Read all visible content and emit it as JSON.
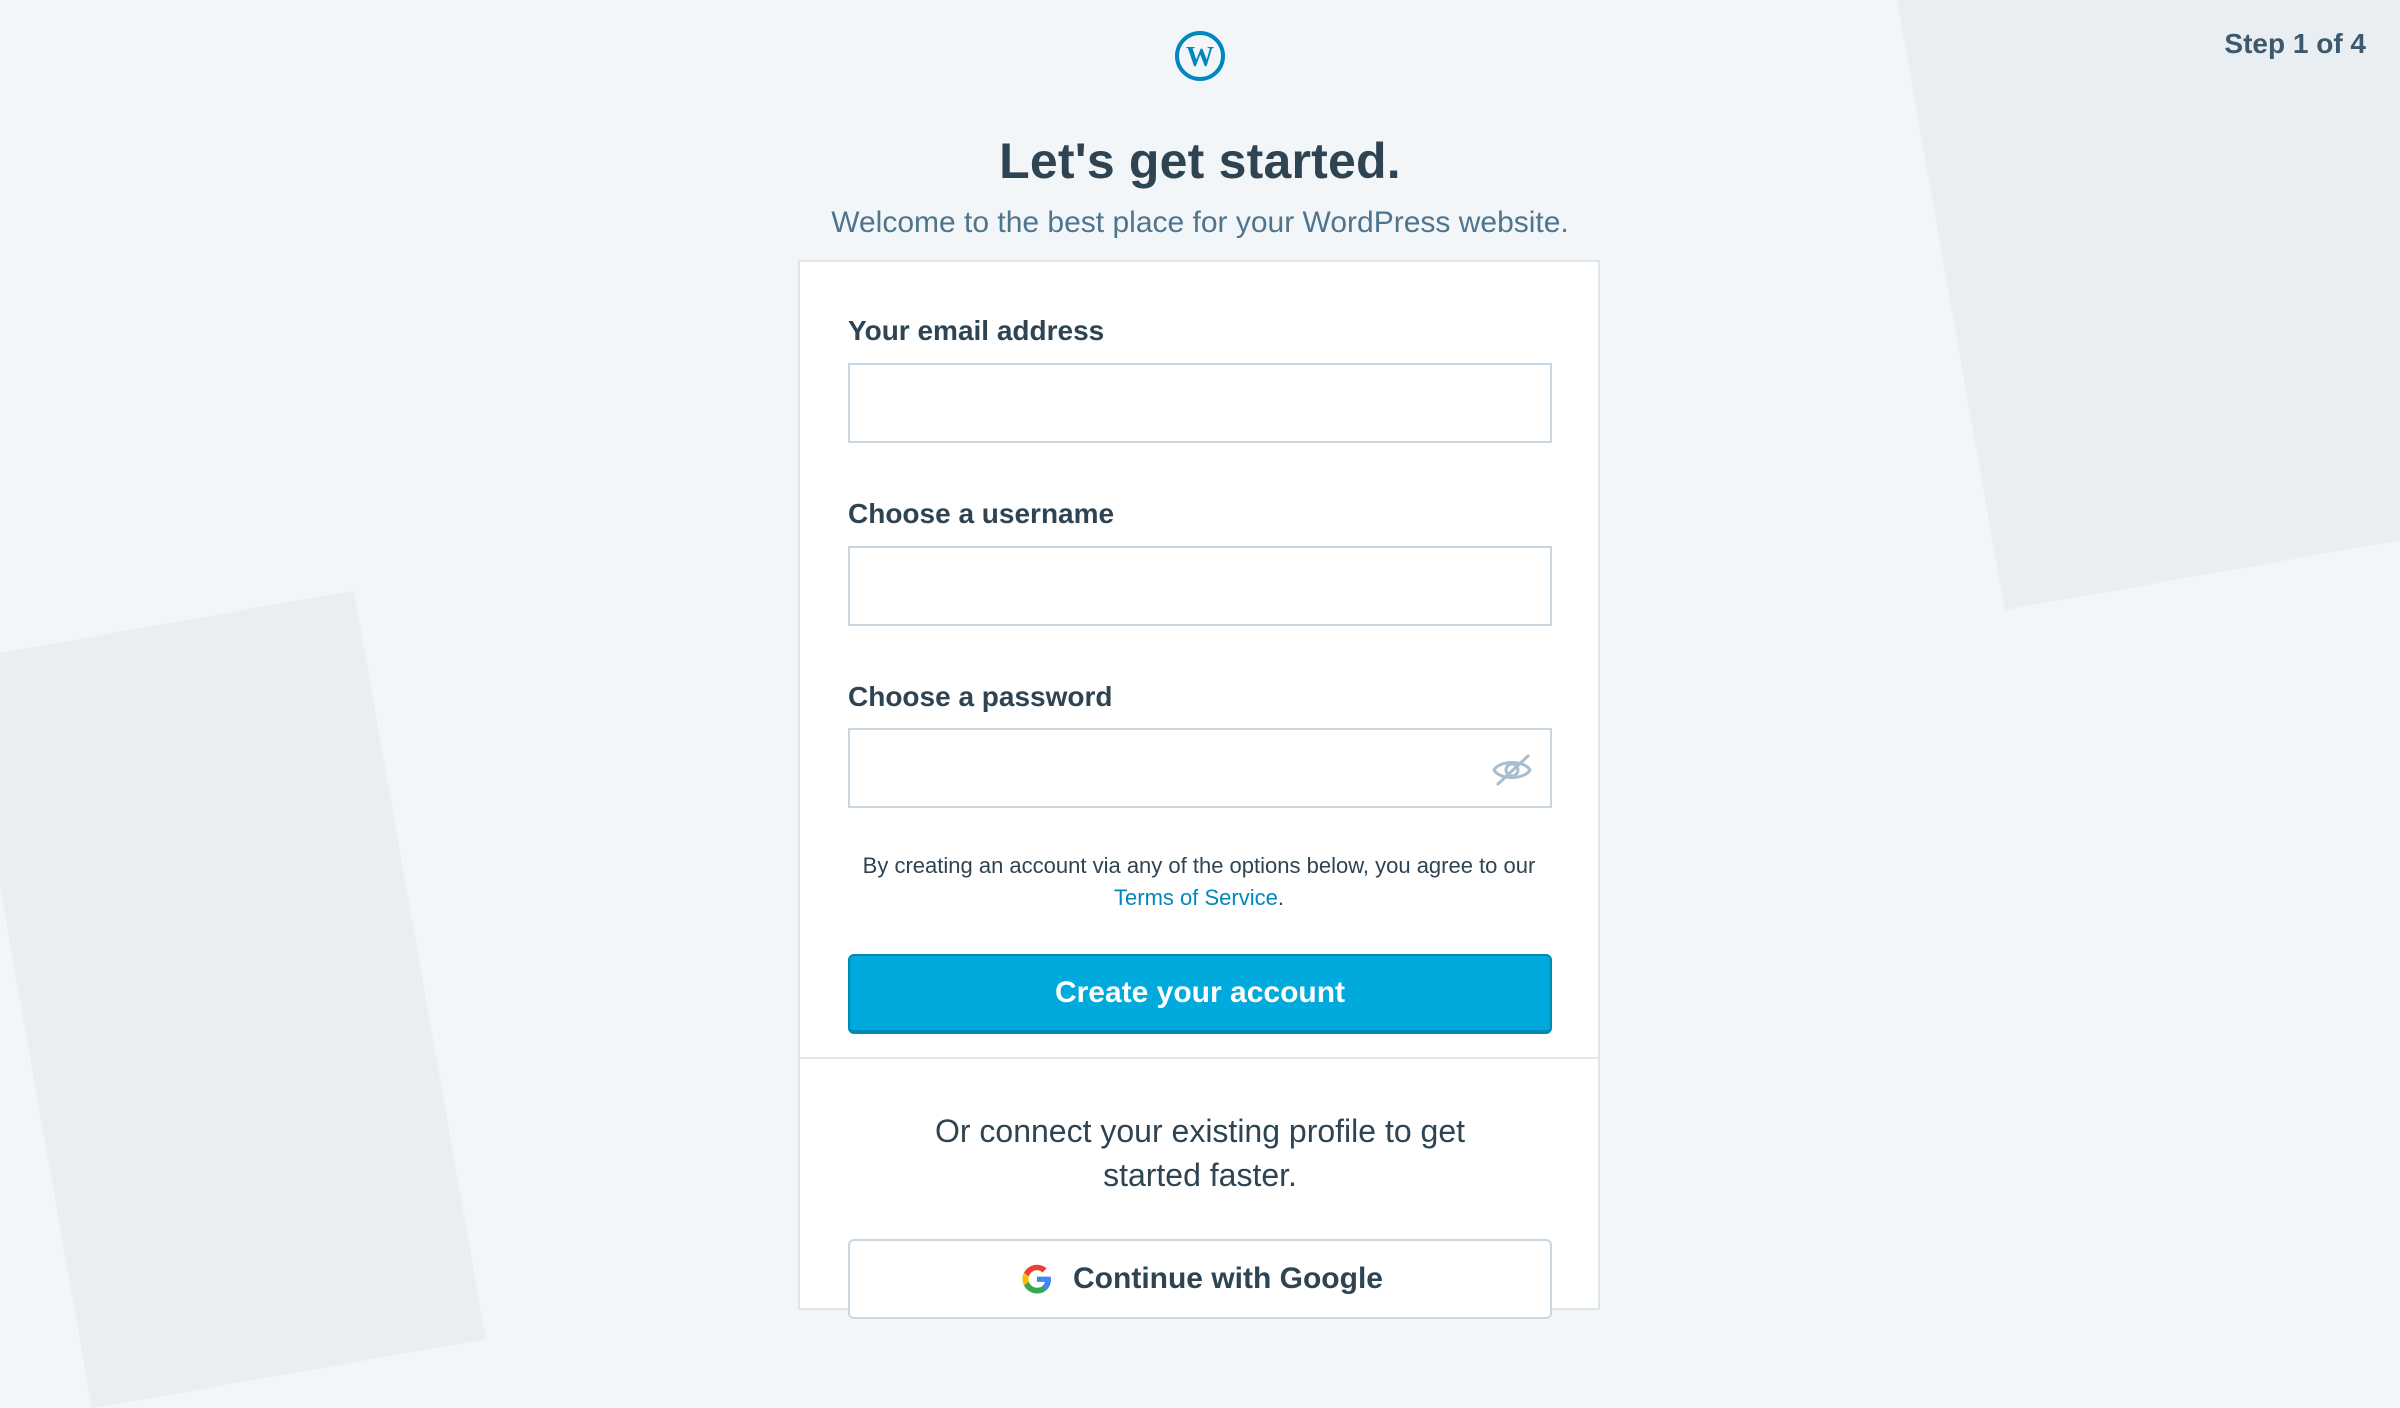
{
  "progress": {
    "step_text": "Step 1 of 4"
  },
  "header": {
    "logo_icon": "wordpress-logo-icon",
    "title": "Let's get started.",
    "subtitle": "Welcome to the best place for your WordPress website."
  },
  "form": {
    "email_label": "Your email address",
    "email_value": "",
    "username_label": "Choose a username",
    "username_value": "",
    "password_label": "Choose a password",
    "password_value": "",
    "password_toggle_icon": "eye-slash-icon",
    "terms_prefix": "By creating an account via any of the options below, you agree to our ",
    "terms_link": "Terms of Service",
    "terms_suffix": ".",
    "submit_label": "Create your account"
  },
  "social": {
    "text": "Or connect your existing profile to get started faster.",
    "google_label": "Continue with Google",
    "google_icon": "google-icon"
  },
  "colors": {
    "accent": "#00aadc",
    "link": "#0087be",
    "text": "#2e4453",
    "subtitle": "#4f748e",
    "background": "#f2f6f9"
  }
}
